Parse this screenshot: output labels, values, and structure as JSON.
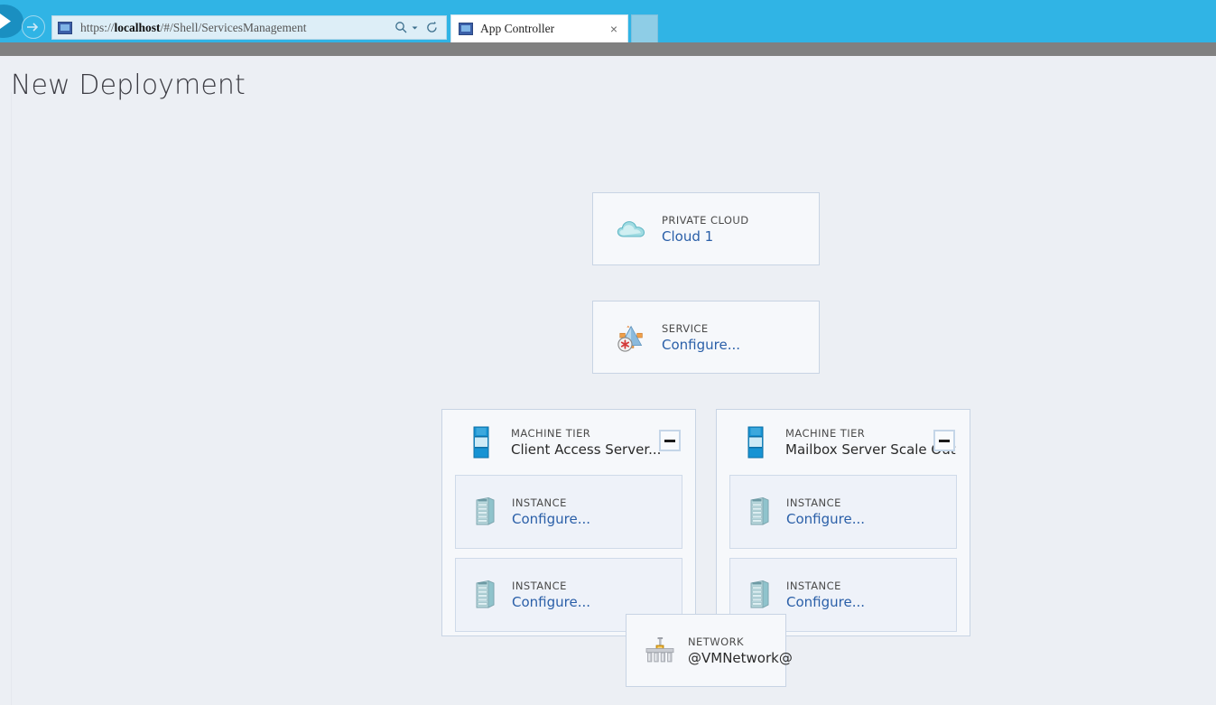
{
  "browser": {
    "back_label": "Back",
    "forward_label": "Forward",
    "url_full": "https://localhost/#/Shell/ServicesManagement",
    "url_scheme": "https://",
    "url_host": "localhost",
    "url_path": "/#/Shell/ServicesManagement",
    "search_icon": "search-icon",
    "search_dropdown_icon": "chevron-down-icon",
    "refresh_icon": "refresh-icon",
    "favicon": "page-icon",
    "tabs": [
      {
        "label": "App Controller",
        "favicon": "page-icon",
        "close_label": "×",
        "active": true
      }
    ],
    "new_tab_label": ""
  },
  "page": {
    "title": "New Deployment"
  },
  "diagram": {
    "cloud": {
      "kind": "PRIVATE CLOUD",
      "value": "Cloud 1",
      "icon": "cloud-icon",
      "value_is_link": true
    },
    "service": {
      "kind": "SERVICE",
      "value": "Configure...",
      "icon": "service-icon",
      "value_is_link": true
    },
    "tiers": [
      {
        "kind": "MACHINE TIER",
        "value": "Client Access Server...",
        "icon": "machine-tier-icon",
        "value_is_link": false,
        "collapse_label": "Collapse",
        "collapse_icon": "minus-icon",
        "instances": [
          {
            "kind": "INSTANCE",
            "value": "Configure...",
            "icon": "instance-icon"
          },
          {
            "kind": "INSTANCE",
            "value": "Configure...",
            "icon": "instance-icon"
          }
        ]
      },
      {
        "kind": "MACHINE TIER",
        "value": "Mailbox Server Scale Out",
        "icon": "machine-tier-icon",
        "value_is_link": false,
        "collapse_label": "Collapse",
        "collapse_icon": "minus-icon",
        "instances": [
          {
            "kind": "INSTANCE",
            "value": "Configure...",
            "icon": "instance-icon"
          },
          {
            "kind": "INSTANCE",
            "value": "Configure...",
            "icon": "instance-icon"
          }
        ]
      }
    ],
    "network": {
      "kind": "NETWORK",
      "value": "@VMNetwork@",
      "icon": "network-icon",
      "value_is_link": false
    }
  },
  "colors": {
    "chrome_blue": "#30b4e5",
    "page_background": "#eceff4",
    "card_background": "#f6f8fb",
    "card_border": "#c8d4e4",
    "link_blue": "#2a5fa8",
    "connector_grey": "#9aa3b0"
  }
}
